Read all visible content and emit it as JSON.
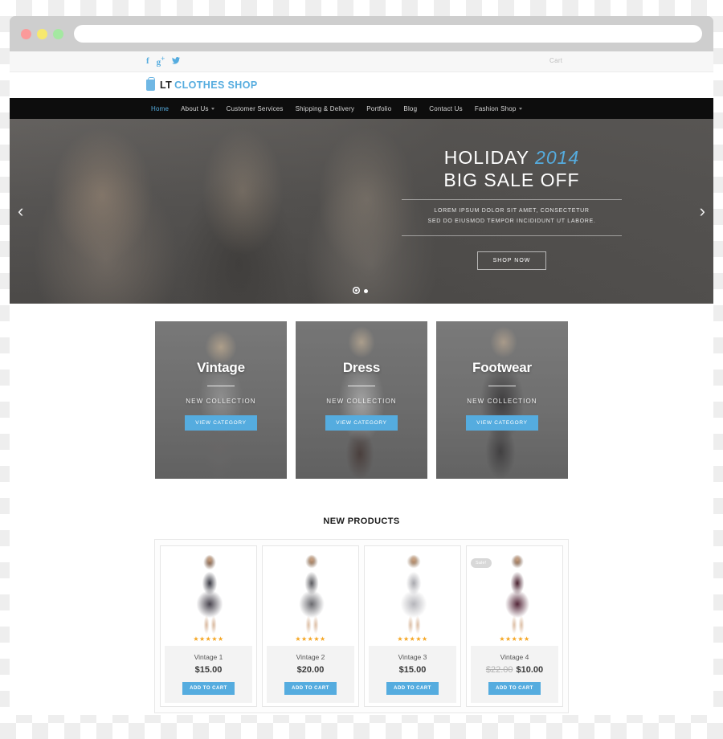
{
  "browser": {
    "traffic_lights": [
      "close",
      "minimize",
      "maximize"
    ],
    "url_value": "",
    "url_placeholder": ""
  },
  "topbar": {
    "social": [
      {
        "name": "facebook-icon",
        "glyph": "f"
      },
      {
        "name": "google-plus-icon",
        "glyph": "g+"
      },
      {
        "name": "twitter-icon",
        "glyph": "✉"
      }
    ],
    "cart_label": "Cart"
  },
  "header": {
    "logo_mark": "shopping-bag-icon",
    "logo_primary": "LT",
    "logo_secondary": "CLOTHES SHOP"
  },
  "nav": {
    "items": [
      {
        "label": "Home",
        "active": true,
        "dropdown": false
      },
      {
        "label": "About Us",
        "active": false,
        "dropdown": true
      },
      {
        "label": "Customer Services",
        "active": false,
        "dropdown": false
      },
      {
        "label": "Shipping & Delivery",
        "active": false,
        "dropdown": false
      },
      {
        "label": "Portfolio",
        "active": false,
        "dropdown": false
      },
      {
        "label": "Blog",
        "active": false,
        "dropdown": false
      },
      {
        "label": "Contact Us",
        "active": false,
        "dropdown": false
      },
      {
        "label": "Fashion Shop",
        "active": false,
        "dropdown": true
      }
    ]
  },
  "hero": {
    "headline_1": "HOLIDAY",
    "headline_year": "2014",
    "headline_2": "BIG SALE OFF",
    "sub_line_1": "LOREM IPSUM DOLOR SIT AMET, CONSECTETUR",
    "sub_line_2": "SED DO EIUSMOD TEMPOR INCIDIDUNT UT LABORE.",
    "cta_label": "SHOP NOW",
    "prev_arrow": "‹",
    "next_arrow": "›",
    "slides": 2,
    "active_slide": 1
  },
  "categories": [
    {
      "title": "Vintage",
      "subtitle": "NEW COLLECTION",
      "button": "VIEW CATEGORY"
    },
    {
      "title": "Dress",
      "subtitle": "NEW COLLECTION",
      "button": "VIEW CATEGORY"
    },
    {
      "title": "Footwear",
      "subtitle": "NEW COLLECTION",
      "button": "VIEW CATEGORY"
    }
  ],
  "new_products": {
    "section_title": "NEW PRODUCTS",
    "items": [
      {
        "name": "Vintage 1",
        "price": "$15.00",
        "old_price": "",
        "stars": "★★★★★",
        "badge": "",
        "button": "ADD TO CART"
      },
      {
        "name": "Vintage 2",
        "price": "$20.00",
        "old_price": "",
        "stars": "★★★★★",
        "badge": "",
        "button": "ADD TO CART"
      },
      {
        "name": "Vintage 3",
        "price": "$15.00",
        "old_price": "",
        "stars": "★★★★★",
        "badge": "",
        "button": "ADD TO CART"
      },
      {
        "name": "Vintage 4",
        "price": "$10.00",
        "old_price": "$22.00",
        "stars": "★★★★★",
        "badge": "Sale!",
        "button": "ADD TO CART"
      }
    ]
  },
  "colors": {
    "accent_blue": "#55acdf",
    "nav_black": "#0d0d0d",
    "star_gold": "#f5a623",
    "badge_gray": "#d8d8d8"
  }
}
